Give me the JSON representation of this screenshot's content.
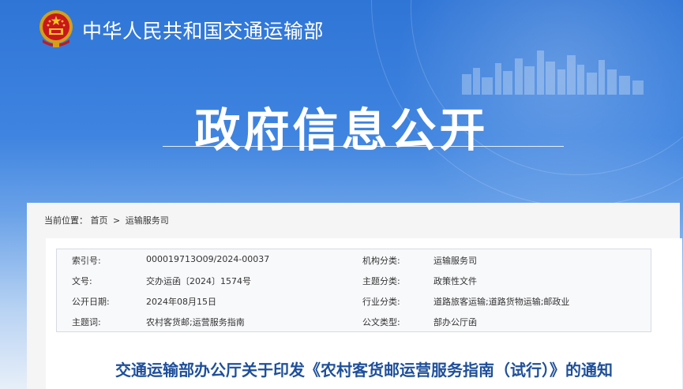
{
  "header": {
    "ministry_name": "中华人民共和国交通运输部",
    "section_title": "政府信息公开",
    "brand_color": "#2f75d6"
  },
  "breadcrumb": {
    "prefix": "当前位置：",
    "items": [
      "首页",
      "运输服务司"
    ],
    "separator": ">"
  },
  "metadata": [
    {
      "label1": "索引号:",
      "value1": "000019713O09/2024-00037",
      "label2": "机构分类:",
      "value2": "运输服务司"
    },
    {
      "label1": "文号:",
      "value1": "交办运函〔2024〕1574号",
      "label2": "主题分类:",
      "value2": "政策性文件"
    },
    {
      "label1": "公开日期:",
      "value1": "2024年08月15日",
      "label2": "行业分类:",
      "value2": "道路旅客运输;道路货物运输;邮政业"
    },
    {
      "label1": "主题词:",
      "value1": "农村客货邮;运营服务指南",
      "label2": "公文类型:",
      "value2": "部办公厅函"
    }
  ],
  "document": {
    "title": "交通运输部办公厅关于印发《农村客货邮运营服务指南（试行）》的通知",
    "title_color": "#1e4f9a"
  },
  "icons": {
    "emblem": "national-emblem-icon"
  }
}
